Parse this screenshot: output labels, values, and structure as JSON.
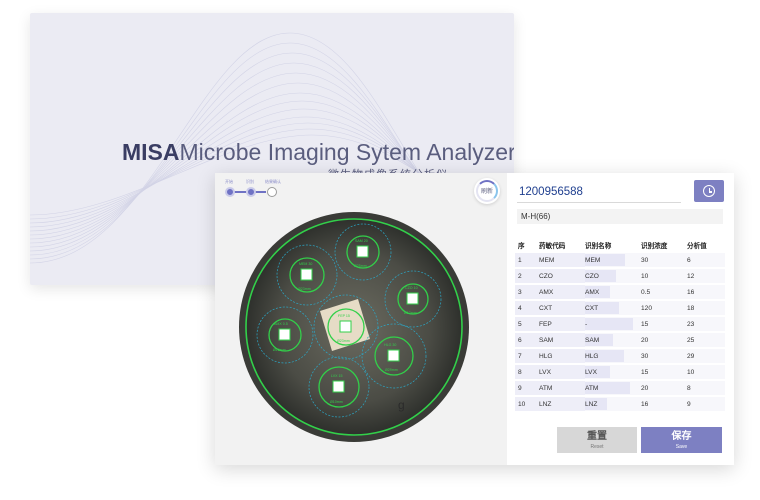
{
  "splash": {
    "brand_short": "MISA",
    "brand_full": "Microbe Imaging Sytem Analyzer",
    "subtitle_cn": "微生物成像系统分析仪"
  },
  "workflow": {
    "steps": [
      {
        "label": "开始",
        "state": "done"
      },
      {
        "label": "识别",
        "state": "done"
      },
      {
        "label": "结果确认",
        "state": "todo"
      }
    ]
  },
  "toolbar": {
    "refresh_label": "刷新"
  },
  "plate": {
    "disks": [
      {
        "code": "MEM 30",
        "zone": "Ø23mm"
      },
      {
        "code": "SAM 20",
        "zone": "Ø25mm"
      },
      {
        "code": "CZO 10",
        "zone": "Ø12mm"
      },
      {
        "code": "AMX 0.5",
        "zone": "Ø16mm"
      },
      {
        "code": "FEP 15",
        "zone": "Ø23mm"
      },
      {
        "code": "HLG 30",
        "zone": "Ø29mm"
      },
      {
        "code": "LVX 15",
        "zone": "Ø10mm"
      },
      {
        "code": "ATM 20",
        "zone": "Ø8mm"
      },
      {
        "code": "LNZ 16",
        "zone": "Ø9mm"
      }
    ]
  },
  "sample": {
    "id": "1200956588",
    "method": "M-H(66)"
  },
  "table": {
    "headers": [
      "序",
      "药敏代码",
      "识别名称",
      "识别浓度",
      "分析值"
    ],
    "rows": [
      {
        "idx": "1",
        "code": "MEM",
        "name": "MEM",
        "conc": "30",
        "value": "6",
        "bar": 0.72
      },
      {
        "idx": "2",
        "code": "CZO",
        "name": "CZO",
        "conc": "10",
        "value": "12",
        "bar": 0.55
      },
      {
        "idx": "3",
        "code": "AMX",
        "name": "AMX",
        "conc": "0.5",
        "value": "16",
        "bar": 0.45
      },
      {
        "idx": "4",
        "code": "CXT",
        "name": "CXT",
        "conc": "120",
        "value": "18",
        "bar": 0.6
      },
      {
        "idx": "5",
        "code": "FEP",
        "name": "-",
        "conc": "15",
        "value": "23",
        "bar": 0.85
      },
      {
        "idx": "6",
        "code": "SAM",
        "name": "SAM",
        "conc": "20",
        "value": "25",
        "bar": 0.5
      },
      {
        "idx": "7",
        "code": "HLG",
        "name": "HLG",
        "conc": "30",
        "value": "29",
        "bar": 0.7
      },
      {
        "idx": "8",
        "code": "LVX",
        "name": "LVX",
        "conc": "15",
        "value": "10",
        "bar": 0.45
      },
      {
        "idx": "9",
        "code": "ATM",
        "name": "ATM",
        "conc": "20",
        "value": "8",
        "bar": 0.8
      },
      {
        "idx": "10",
        "code": "LNZ",
        "name": "LNZ",
        "conc": "16",
        "value": "9",
        "bar": 0.4
      }
    ]
  },
  "actions": {
    "reset_label": "重置",
    "reset_sub": "Reset",
    "save_label": "保存",
    "save_sub": "Save"
  },
  "colors": {
    "accent": "#7d80c2",
    "link_blue": "#3b6fb3",
    "zone_green": "#32d04a",
    "zone_cyan": "#2aa8c8"
  },
  "icons": {
    "history": "clock-icon",
    "refresh": "refresh-ring-icon"
  }
}
